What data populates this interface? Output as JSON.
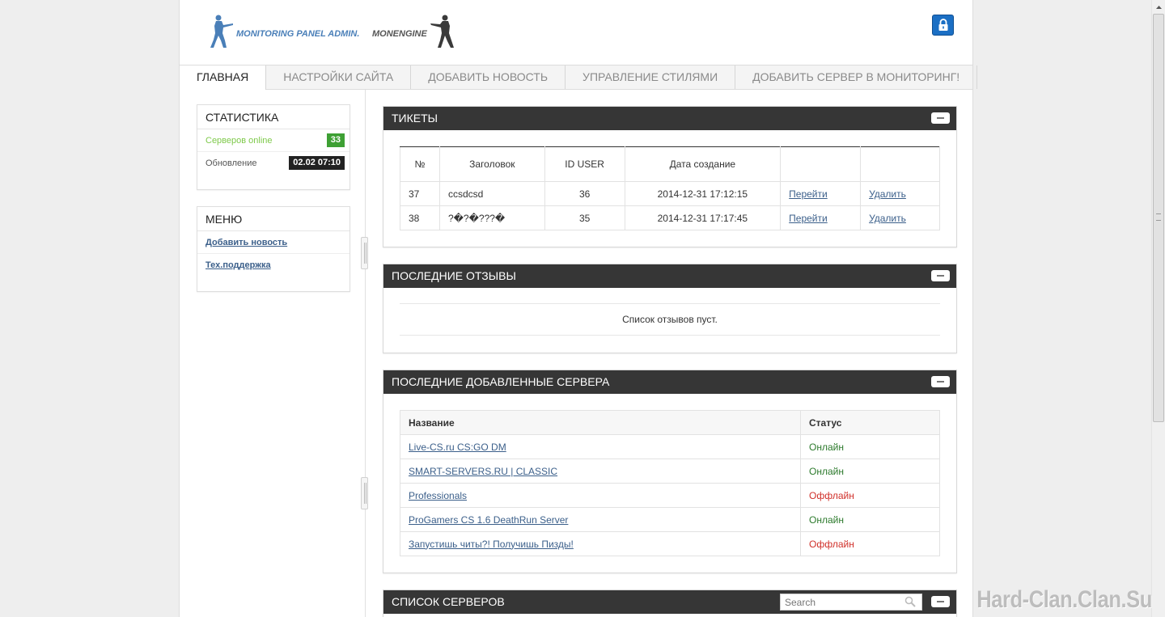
{
  "header": {
    "logo_primary": "MONITORING PANEL ADMIN.",
    "logo_secondary": "MONENGINE",
    "lock_icon": "lock-icon"
  },
  "nav": {
    "items": [
      {
        "label": "ГЛАВНАЯ",
        "active": true
      },
      {
        "label": "НАСТРОЙКИ САЙТА",
        "active": false
      },
      {
        "label": "ДОБАВИТЬ НОВОСТЬ",
        "active": false
      },
      {
        "label": "УПРАВЛЕНИЕ СТИЛЯМИ",
        "active": false
      },
      {
        "label": "ДОБАВИТЬ СЕРВЕР В МОНИТОРИНГ!",
        "active": false
      }
    ]
  },
  "sidebar": {
    "stats": {
      "title": "СТАТИСТИКА",
      "servers_online_label": "Серверов online",
      "servers_online_value": "33",
      "update_label": "Обновление",
      "update_value": "02.02 07:10",
      "online_color": "#7ec94a"
    },
    "menu": {
      "title": "МЕНЮ",
      "items": [
        "Добавить новость",
        "Тех.поддержка"
      ]
    }
  },
  "tickets": {
    "title": "ТИКЕТЫ",
    "columns": [
      "№",
      "Заголовок",
      "ID USER",
      "Дата создание",
      "",
      ""
    ],
    "rows": [
      {
        "num": "37",
        "title": "ccsdcsd",
        "user": "36",
        "date": "2014-12-31 17:12:15",
        "go": "Перейти",
        "del": "Удалить"
      },
      {
        "num": "38",
        "title": "?�?�???�",
        "user": "35",
        "date": "2014-12-31 17:17:45",
        "go": "Перейти",
        "del": "Удалить"
      }
    ]
  },
  "reviews": {
    "title": "ПОСЛЕДНИЕ ОТЗЫВЫ",
    "empty_text": "Список отзывов пуст."
  },
  "latest_servers": {
    "title": "ПОСЛЕДНИЕ ДОБАВЛЕННЫЕ СЕРВЕРА",
    "columns": [
      "Название",
      "Статус"
    ],
    "rows": [
      {
        "name": "Live-CS.ru CS:GO DM",
        "status": "Онлайн",
        "online": true
      },
      {
        "name": "SMART-SERVERS.RU | CLASSIC",
        "status": "Онлайн",
        "online": true
      },
      {
        "name": "Professionals",
        "status": "Оффлайн",
        "online": false
      },
      {
        "name": "ProGamers CS 1.6 DeathRun Server",
        "status": "Онлайн",
        "online": true
      },
      {
        "name": "Запустишь читы?! Получишь Пизды!",
        "status": "Оффлайн",
        "online": false
      }
    ]
  },
  "server_list": {
    "title": "СПИСОК СЕРВЕРОВ",
    "search_placeholder": "Search"
  },
  "watermark": "Hard-Clan.Clan.Su",
  "colors": {
    "panel_head": "#363636",
    "online": "#2c7a2c",
    "offline": "#d0302a",
    "link": "#3b5f8a",
    "lock": "#1b6fc4"
  }
}
